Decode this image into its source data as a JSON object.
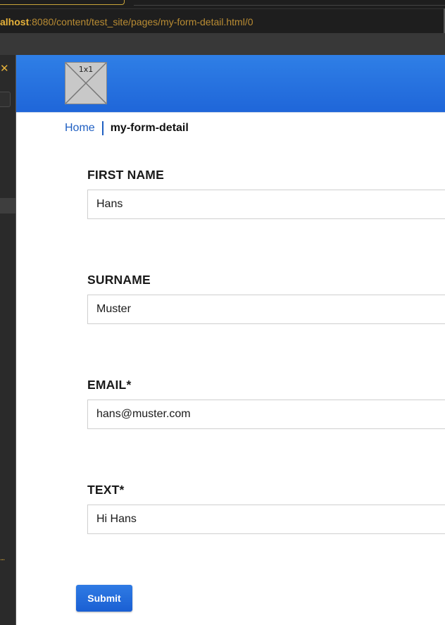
{
  "browser": {
    "url_host": "alhost",
    "url_rest": ":8080/content/test_site/pages/my-form-detail.html/0"
  },
  "header": {
    "logo_label": "1x1"
  },
  "breadcrumb": {
    "home": "Home",
    "current": "my-form-detail"
  },
  "form": {
    "fields": [
      {
        "label": "FIRST NAME",
        "value": "Hans"
      },
      {
        "label": "SURNAME",
        "value": "Muster"
      },
      {
        "label": "EMAIL*",
        "value": "hans@muster.com"
      },
      {
        "label": "TEXT*",
        "value": "Hi Hans"
      }
    ],
    "submit_label": "Submit"
  },
  "sidebar": {
    "close_icon": "close-icon",
    "dots": "..."
  },
  "colors": {
    "brand": "#1f66d9",
    "link": "#1f5fc2",
    "accent": "#e6b23a"
  }
}
